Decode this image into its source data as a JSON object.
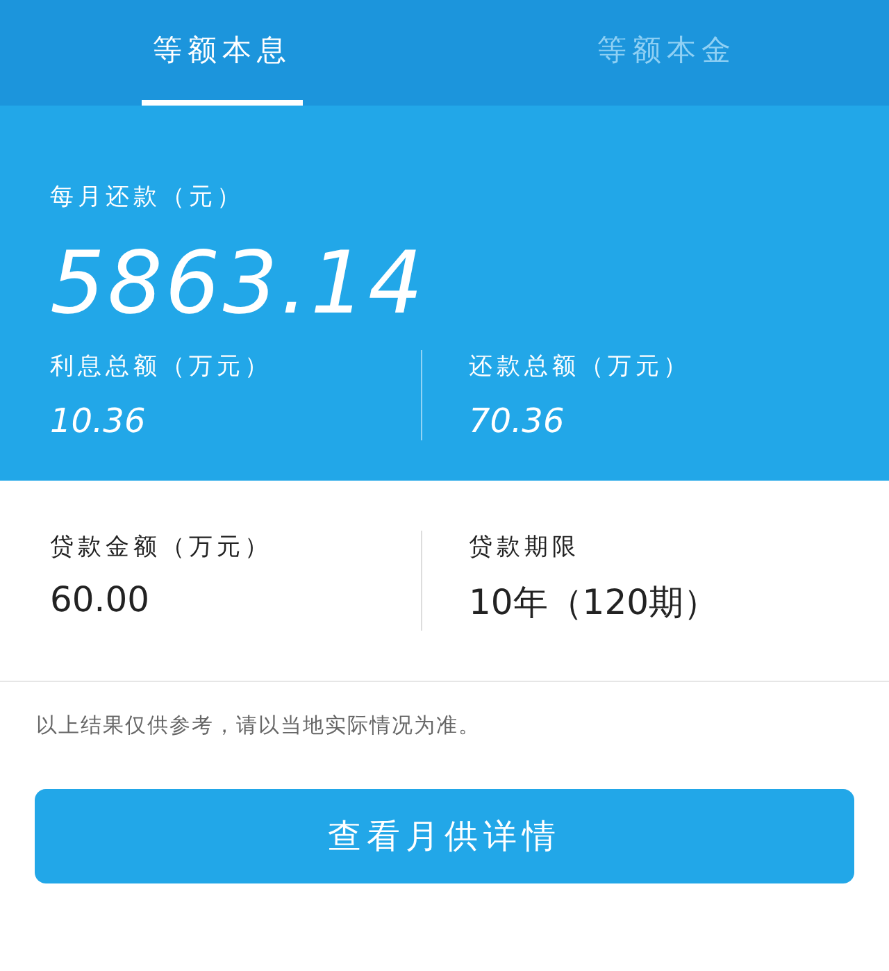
{
  "tabs": [
    {
      "label": "等额本息",
      "selected": true
    },
    {
      "label": "等额本金",
      "selected": false
    }
  ],
  "summary": {
    "monthly_label": "每月还款（元）",
    "monthly_value": "5863.14",
    "stats": [
      {
        "label": "利息总额（万元）",
        "value": "10.36"
      },
      {
        "label": "还款总额（万元）",
        "value": "70.36"
      }
    ]
  },
  "loan": [
    {
      "label": "贷款金额（万元）",
      "value": "60.00"
    },
    {
      "label": "贷款期限",
      "value": "10年（120期）"
    }
  ],
  "note": "以上结果仅供参考，请以当地实际情况为准。",
  "button": "查看月供详情"
}
